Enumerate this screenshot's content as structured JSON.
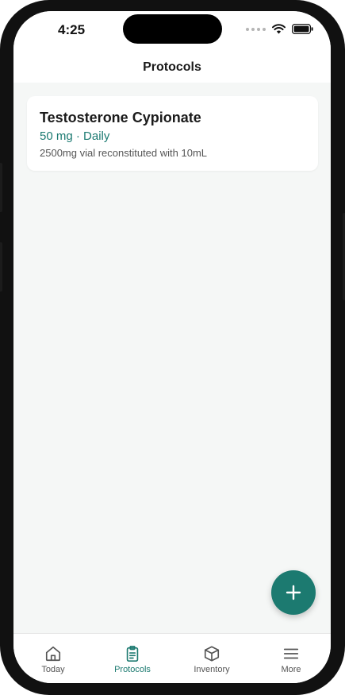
{
  "status_bar": {
    "time": "4:25"
  },
  "header": {
    "title": "Protocols"
  },
  "protocols": [
    {
      "name": "Testosterone Cypionate",
      "dose": "50 mg · Daily",
      "description": "2500mg vial reconstituted with 10mL"
    }
  ],
  "fab": {
    "icon": "plus-icon"
  },
  "tabs": [
    {
      "label": "Today",
      "icon": "home-icon",
      "active": false
    },
    {
      "label": "Protocols",
      "icon": "clipboard-icon",
      "active": true
    },
    {
      "label": "Inventory",
      "icon": "box-icon",
      "active": false
    },
    {
      "label": "More",
      "icon": "menu-icon",
      "active": false
    }
  ],
  "colors": {
    "accent": "#1c7a70",
    "background": "#f5f7f6",
    "card": "#ffffff",
    "inactive_tab": "#555555"
  }
}
